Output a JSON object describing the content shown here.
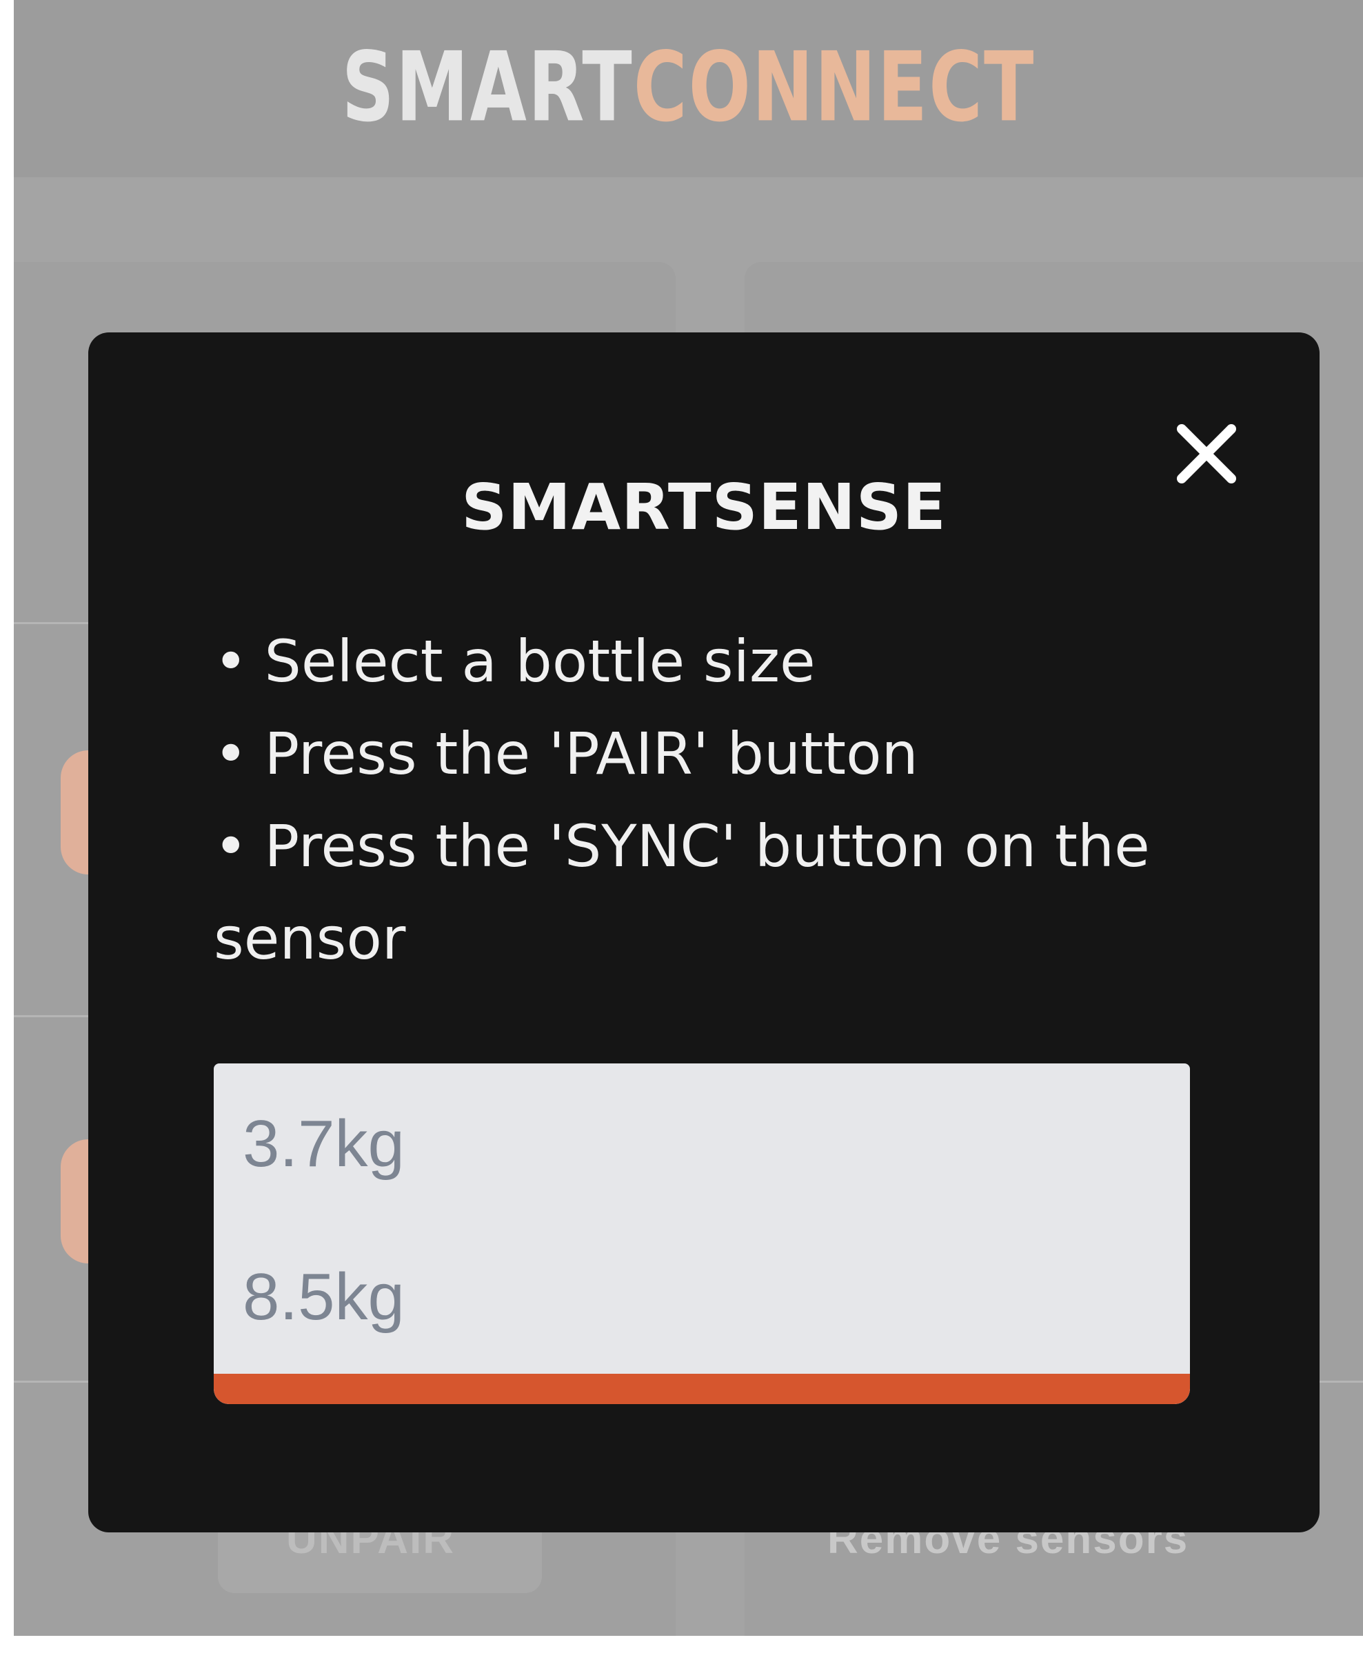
{
  "header": {
    "logo_first": "Smart",
    "logo_second": "Connect",
    "logo_first_color": "#e6e6e6",
    "logo_second_color": "#e8b89a"
  },
  "background": {
    "unpair_label": "UNPAIR",
    "remove_label": "Remove sensors"
  },
  "modal": {
    "title": "SMARTSENSE",
    "close_icon": "close-icon",
    "instructions": [
      "Select a bottle size",
      "Press the 'PAIR' button",
      "Press the 'SYNC' button on the",
      "sensor"
    ],
    "bottle_options": [
      "3.7kg",
      "8.5kg"
    ],
    "accent_color": "#d6562e"
  }
}
